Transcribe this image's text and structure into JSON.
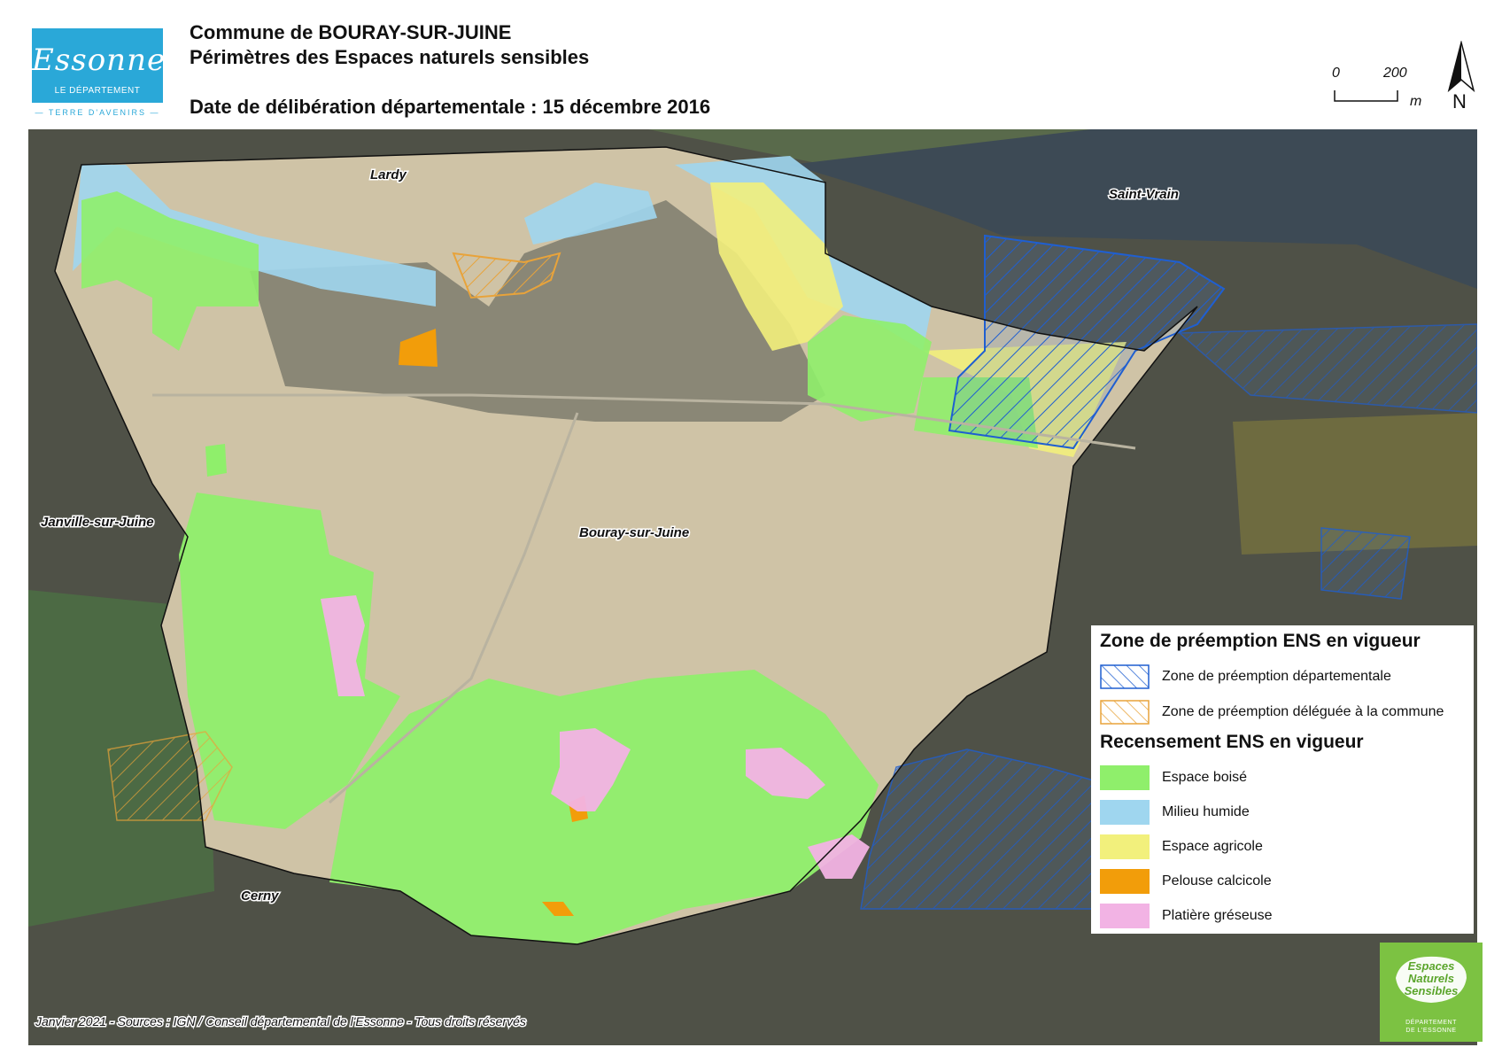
{
  "header": {
    "commune": "Commune de BOURAY-SUR-JUINE",
    "subtitle": "Périmètres des Espaces naturels sensibles",
    "date_line": "Date de délibération départementale : 15 décembre 2016"
  },
  "logo": {
    "wordmark": "Essonne",
    "subtitle": "LE DÉPARTEMENT",
    "tagline": "— TERRE D'AVENIRS —",
    "color": "#2aa8d8"
  },
  "scale": {
    "start": "0",
    "end": "200",
    "unit": "m"
  },
  "north": {
    "label": "N"
  },
  "places": {
    "lardy": "Lardy",
    "saint_vrain": "Saint-Vrain",
    "janville": "Janville-sur-Juine",
    "bouray": "Bouray-sur-Juine",
    "cerny": "Cerny"
  },
  "legend": {
    "preemption_title": "Zone de préemption ENS en vigueur",
    "preemption_items": [
      {
        "label": "Zone de préemption départementale",
        "color": "#1f5fd1"
      },
      {
        "label": "Zone de préemption déléguée à la commune",
        "color": "#e8a33a"
      }
    ],
    "census_title": "Recensement ENS en vigueur",
    "census_items": [
      {
        "label": "Espace boisé",
        "color": "#8fef6b"
      },
      {
        "label": "Milieu humide",
        "color": "#9fd6ef"
      },
      {
        "label": "Espace agricole",
        "color": "#f2f07c"
      },
      {
        "label": "Pelouse calcicole",
        "color": "#f29d0a"
      },
      {
        "label": "Platière gréseuse",
        "color": "#f2b3e4"
      }
    ]
  },
  "footer": "Janvier 2021 - Sources : IGN / Conseil départemental de l'Essonne - Tous droits réservés",
  "ens_logo": {
    "title_lines": [
      "Espaces",
      "Naturels",
      "Sensibles"
    ],
    "dept_lines": [
      "DÉPARTEMENT",
      "DE L'ESSONNE"
    ],
    "color": "#7cc242"
  }
}
